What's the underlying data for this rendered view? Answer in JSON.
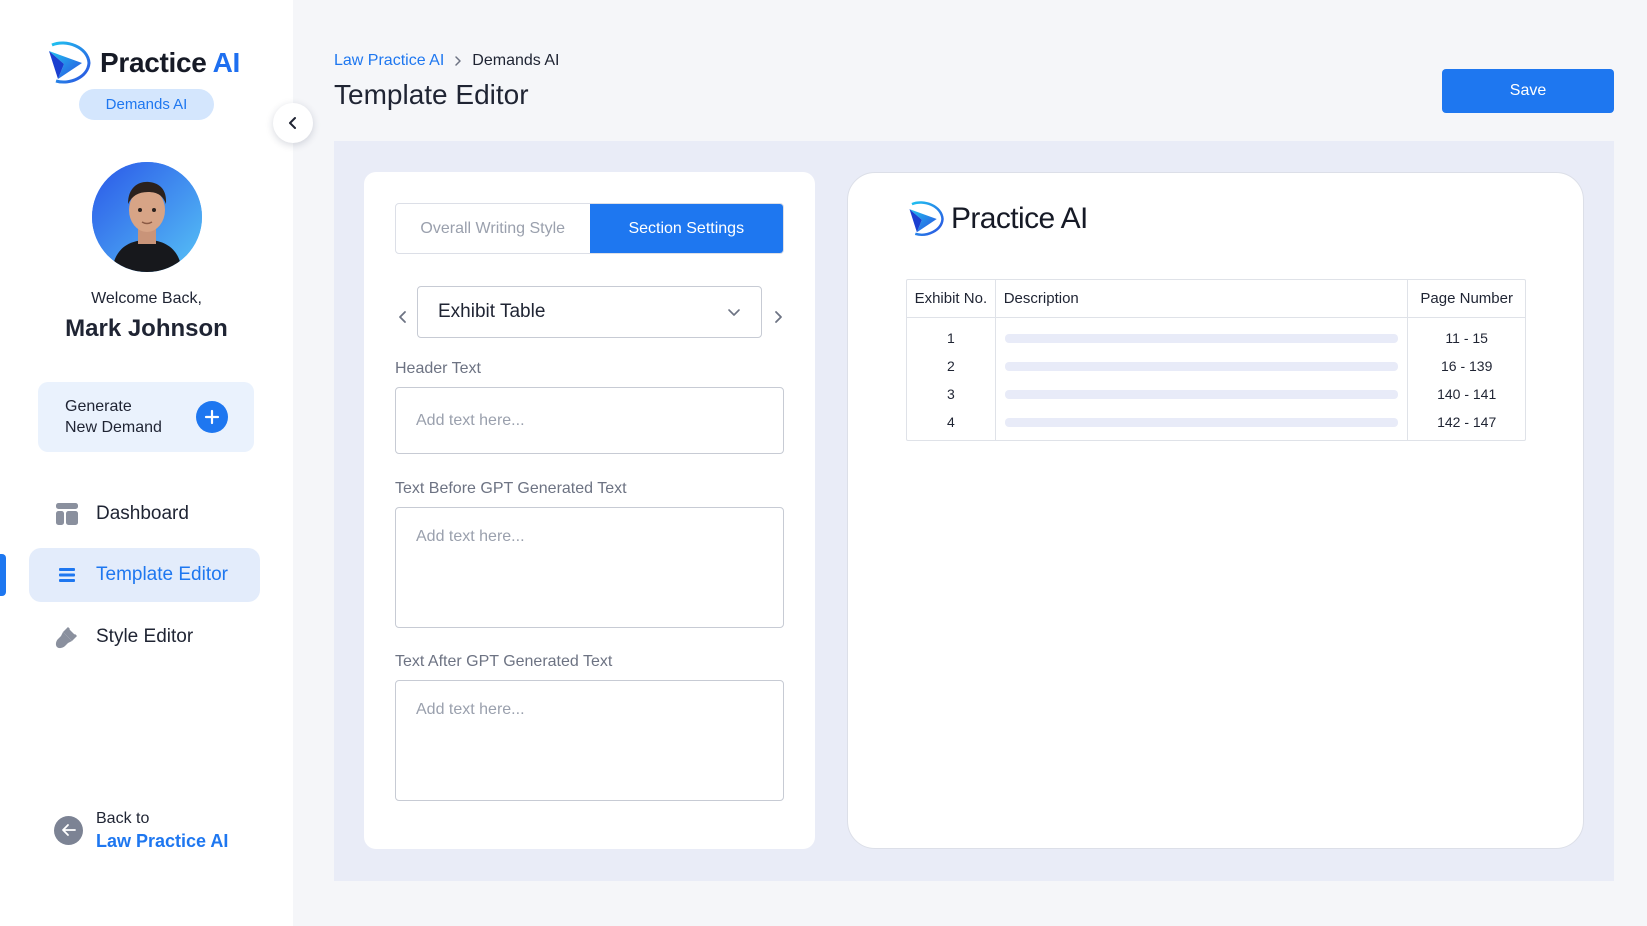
{
  "app": {
    "brand_word": "Practice",
    "brand_accent": "AI",
    "product_badge": "Demands AI"
  },
  "user": {
    "welcome": "Welcome Back,",
    "name": "Mark Johnson"
  },
  "sidebar": {
    "generate_line1": "Generate",
    "generate_line2": "New Demand",
    "items": [
      {
        "label": "Dashboard",
        "icon": "dashboard-icon",
        "active": false
      },
      {
        "label": "Template Editor",
        "icon": "list-icon",
        "active": true
      },
      {
        "label": "Style Editor",
        "icon": "brush-icon",
        "active": false
      }
    ],
    "back_line1": "Back to",
    "back_line2": "Law Practice AI"
  },
  "header": {
    "breadcrumb": [
      "Law Practice AI",
      "Demands AI"
    ],
    "title": "Template Editor",
    "save_label": "Save"
  },
  "editor": {
    "tabs": [
      {
        "label": "Overall Writing Style",
        "active": false
      },
      {
        "label": "Section Settings",
        "active": true
      }
    ],
    "section_select": "Exhibit Table",
    "fields": [
      {
        "label": "Header Text",
        "placeholder": "Add text here..."
      },
      {
        "label": "Text Before GPT Generated Text",
        "placeholder": "Add text here..."
      },
      {
        "label": "Text After GPT Generated Text",
        "placeholder": "Add text here..."
      }
    ]
  },
  "preview": {
    "logo_text": "Practice AI",
    "columns": [
      "Exhibit No.",
      "Description",
      "Page Number"
    ],
    "rows": [
      {
        "no": "1",
        "pages": "11 - 15"
      },
      {
        "no": "2",
        "pages": "16 - 139"
      },
      {
        "no": "3",
        "pages": "140 - 141"
      },
      {
        "no": "4",
        "pages": "142 - 147"
      }
    ]
  },
  "colors": {
    "accent": "#1e77f0",
    "active_nav_bg": "#e3ecfb",
    "workspace_bg": "#e9ecf7"
  }
}
